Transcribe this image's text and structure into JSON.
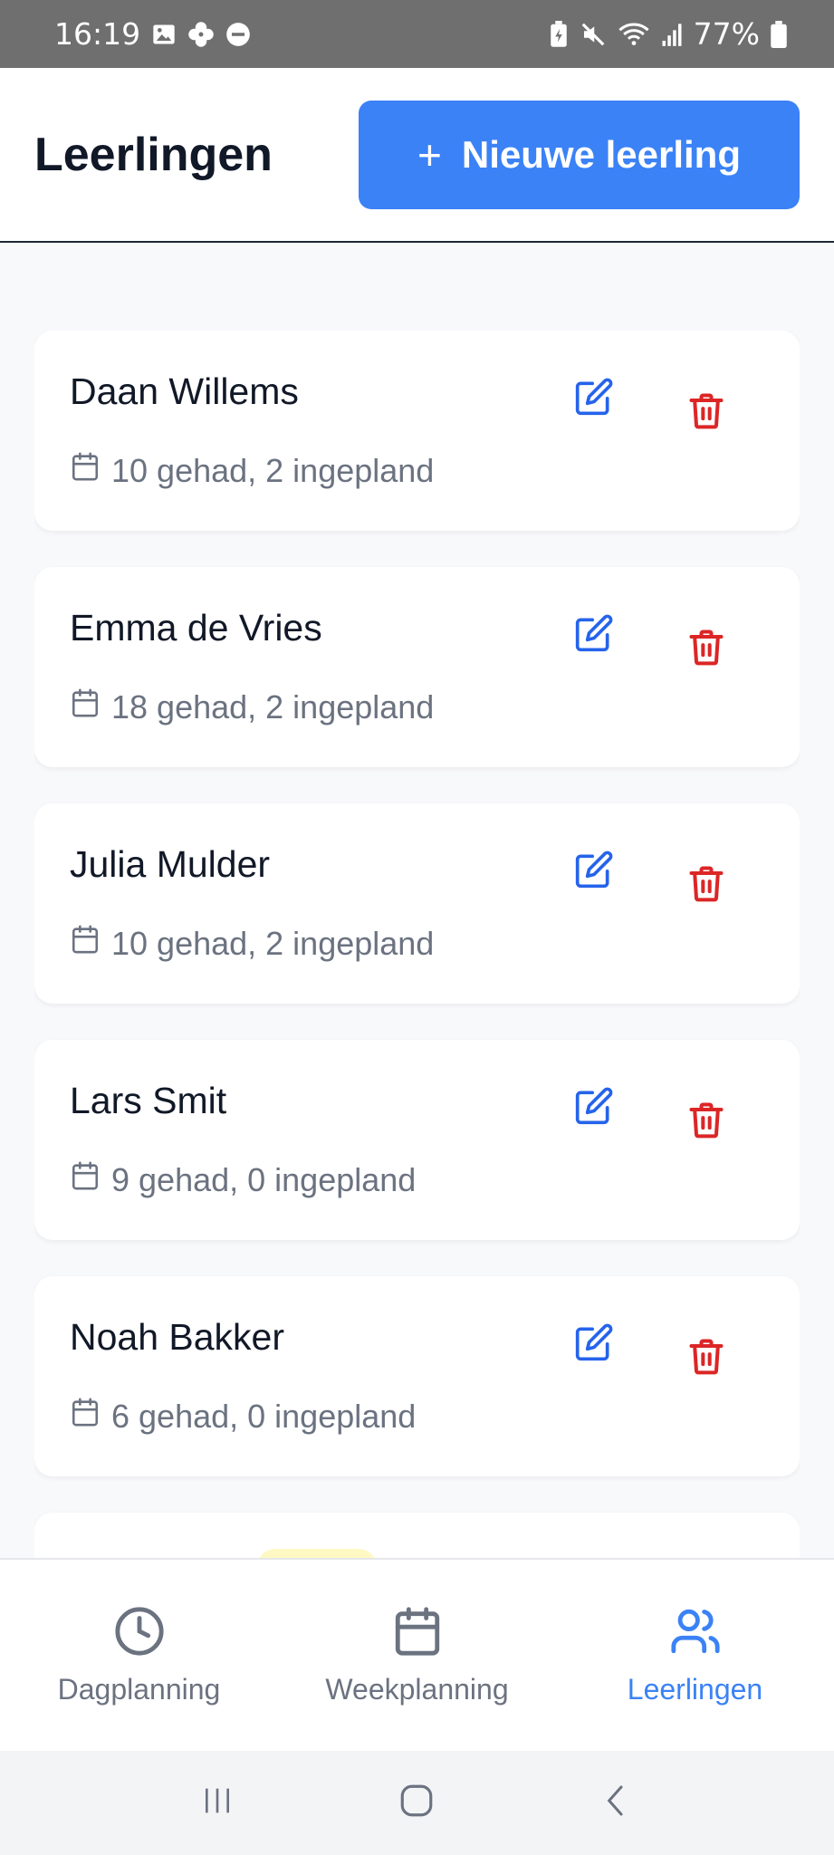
{
  "status_bar": {
    "time": "16:19",
    "battery_percent": "77%",
    "icons": [
      "image-icon",
      "pinwheel-icon",
      "dnd-icon",
      "battery-saver-icon",
      "mute-icon",
      "wifi-icon",
      "signal-icon",
      "battery-icon"
    ]
  },
  "header": {
    "title": "Leerlingen",
    "new_button": {
      "icon": "+",
      "label": "Nieuwe leerling"
    }
  },
  "students": [
    {
      "name": "Daan Willems",
      "lessons": "10 gehad, 2 ingepland"
    },
    {
      "name": "Emma de Vries",
      "lessons": "18 gehad, 2 ingepland"
    },
    {
      "name": "Julia Mulder",
      "lessons": "10 gehad, 2 ingepland"
    },
    {
      "name": "Lars Smit",
      "lessons": "9 gehad, 0 ingepland"
    },
    {
      "name": "Noah Bakker",
      "lessons": "6 gehad, 0 ingepland"
    }
  ],
  "bottom_nav": {
    "items": [
      {
        "label": "Dagplanning",
        "icon": "clock-icon",
        "active": false
      },
      {
        "label": "Weekplanning",
        "icon": "calendar-icon",
        "active": false
      },
      {
        "label": "Leerlingen",
        "icon": "users-icon",
        "active": true
      }
    ]
  },
  "colors": {
    "primary": "#3b82f6",
    "edit_icon": "#2563eb",
    "delete_icon": "#dc2626",
    "text_muted": "#6b7280",
    "status_bar": "#6f6f6f"
  }
}
